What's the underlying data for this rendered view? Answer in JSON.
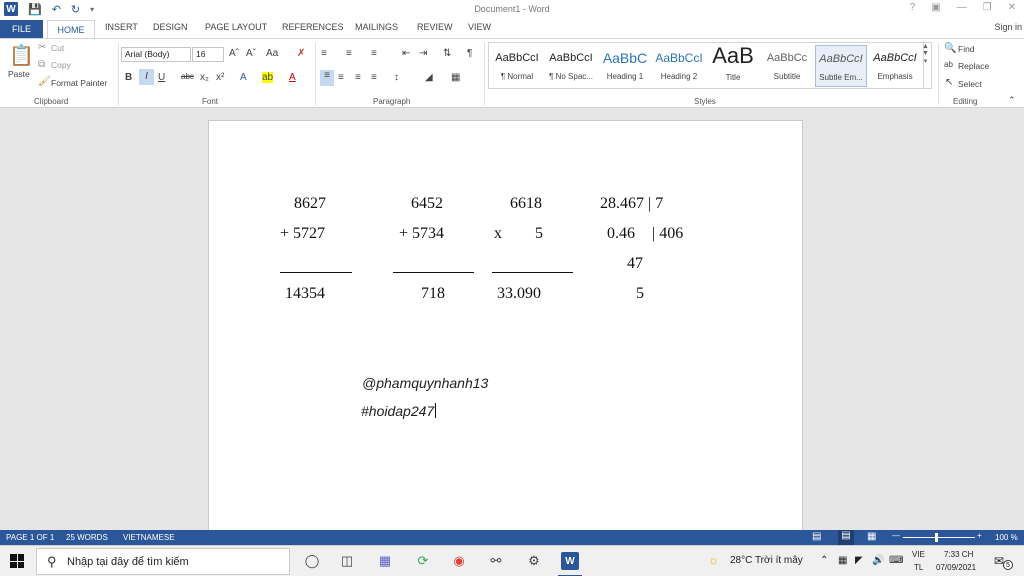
{
  "window": {
    "title": "Document1 - Word",
    "sign_in": "Sign in"
  },
  "tabs": [
    "FILE",
    "HOME",
    "INSERT",
    "DESIGN",
    "PAGE LAYOUT",
    "REFERENCES",
    "MAILINGS",
    "REVIEW",
    "VIEW"
  ],
  "ribbon": {
    "clipboard": {
      "paste": "Paste",
      "cut": "Cut",
      "copy": "Copy",
      "format_painter": "Format Painter",
      "label": "Clipboard"
    },
    "font": {
      "family": "Arial (Body)",
      "size": "16",
      "label": "Font"
    },
    "paragraph": {
      "label": "Paragraph"
    },
    "styles": {
      "label": "Styles",
      "items": [
        {
          "sample": "AaBbCcI",
          "name": "¶ Normal"
        },
        {
          "sample": "AaBbCcI",
          "name": "¶ No Spac..."
        },
        {
          "sample": "AaBbC",
          "name": "Heading 1"
        },
        {
          "sample": "AaBbCcI",
          "name": "Heading 2"
        },
        {
          "sample": "AaB",
          "name": "Title"
        },
        {
          "sample": "AaBbCc",
          "name": "Subtitle"
        },
        {
          "sample": "AaBbCcI",
          "name": "Subtle Em..."
        },
        {
          "sample": "AaBbCcI",
          "name": "Emphasis"
        }
      ]
    },
    "editing": {
      "find": "Find",
      "replace": "Replace",
      "select": "Select",
      "label": "Editing"
    }
  },
  "document": {
    "col1": {
      "a": "8627",
      "b": "+ 5727",
      "result": "14354"
    },
    "col2": {
      "a": "6452",
      "b": "+ 5734",
      "result": "718"
    },
    "col3": {
      "a": "6618",
      "op": "x",
      "b": "5",
      "result": "33.090"
    },
    "col4": {
      "line1": "28.467 | 7",
      "line2a": "0.46",
      "line2b": "| 406",
      "line3": "47",
      "line4": "5"
    },
    "signature": "@phamquynhanh13",
    "hashtag": "#hoidap247"
  },
  "statusbar": {
    "page": "PAGE 1 OF 1",
    "words": "25 WORDS",
    "language": "VIETNAMESE",
    "zoom": "100 %"
  },
  "taskbar": {
    "search_placeholder": "Nhập tại đây để tìm kiếm",
    "weather": "28°C  Trời ít mây",
    "lang": "VIE",
    "lang2": "TL",
    "time": "7:33 CH",
    "date": "07/09/2021",
    "notifications": "5"
  }
}
